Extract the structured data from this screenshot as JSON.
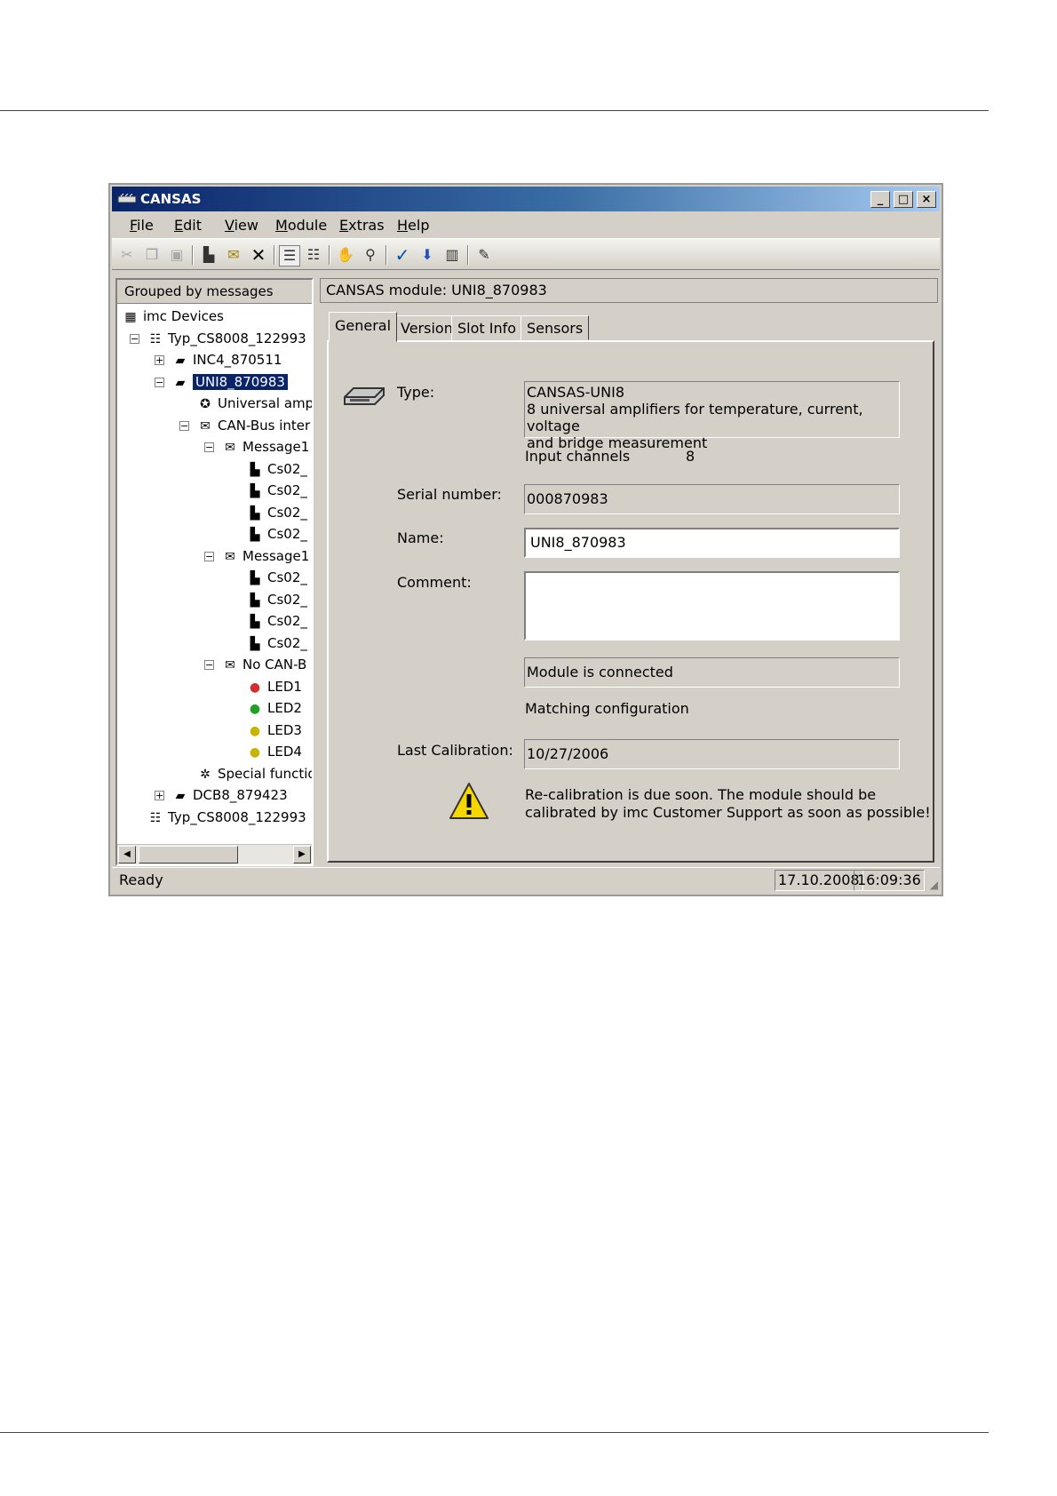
{
  "window": {
    "title": "CANSAS"
  },
  "menu": [
    {
      "label": "File",
      "key": "F",
      "rest": "ile"
    },
    {
      "label": "Edit",
      "key": "E",
      "rest": "dit"
    },
    {
      "label": "View",
      "key": "V",
      "rest": "iew"
    },
    {
      "label": "Module",
      "key": "M",
      "rest": "odule"
    },
    {
      "label": "Extras",
      "key": "E",
      "rest": "xtras"
    },
    {
      "label": "Help",
      "key": "H",
      "rest": "elp"
    }
  ],
  "left_panel": {
    "header": "Grouped by messages",
    "tree": [
      {
        "label": "imc Devices",
        "icon": "devices-icon",
        "glyph": "▦"
      },
      {
        "label": "Typ_CS8008_122993",
        "icon": "rack-icon",
        "glyph": "☷"
      },
      {
        "label": "INC4_870511",
        "icon": "module-icon",
        "glyph": "▰"
      },
      {
        "label": "UNI8_870983",
        "icon": "module-icon",
        "glyph": "▰"
      },
      {
        "label": "Universal amp",
        "icon": "amplifier-icon",
        "glyph": "✪"
      },
      {
        "label": "CAN-Bus inter",
        "icon": "can-bus-icon",
        "glyph": "✉"
      },
      {
        "label": "Message1",
        "icon": "envelope-icon",
        "glyph": "✉"
      },
      {
        "label": "Cs02_",
        "icon": "channel-icon",
        "glyph": "▙"
      },
      {
        "label": "Cs02_",
        "icon": "channel-icon",
        "glyph": "▙"
      },
      {
        "label": "Cs02_",
        "icon": "channel-icon",
        "glyph": "▙"
      },
      {
        "label": "Cs02_",
        "icon": "channel-icon",
        "glyph": "▙"
      },
      {
        "label": "Message1",
        "icon": "envelope-icon",
        "glyph": "✉"
      },
      {
        "label": "Cs02_",
        "icon": "channel-icon",
        "glyph": "▙"
      },
      {
        "label": "Cs02_",
        "icon": "channel-icon",
        "glyph": "▙"
      },
      {
        "label": "Cs02_",
        "icon": "channel-icon",
        "glyph": "▙"
      },
      {
        "label": "Cs02_",
        "icon": "channel-icon",
        "glyph": "▙"
      },
      {
        "label": "No CAN-B",
        "icon": "envelope-crossed-icon",
        "glyph": "✉"
      },
      {
        "label": "LED1",
        "icon": "led-red-icon",
        "glyph": "●",
        "color": "#d03030"
      },
      {
        "label": "LED2",
        "icon": "led-green-icon",
        "glyph": "●",
        "color": "#22a022"
      },
      {
        "label": "LED3",
        "icon": "led-yellow-icon",
        "glyph": "●",
        "color": "#c8b400"
      },
      {
        "label": "LED4",
        "icon": "led-yellow-icon",
        "glyph": "●",
        "color": "#c8b400"
      },
      {
        "label": "Special functio",
        "icon": "gear-icon",
        "glyph": "✲"
      },
      {
        "label": "DCB8_879423",
        "icon": "module-icon",
        "glyph": "▰"
      },
      {
        "label": "Typ_CS8008_122993",
        "icon": "rack-icon",
        "glyph": "☷"
      }
    ]
  },
  "right_panel": {
    "header": "CANSAS module: UNI8_870983",
    "tabs": [
      "General",
      "Version",
      "Slot Info",
      "Sensors"
    ],
    "general": {
      "type_label": "Type:",
      "type_line1": "CANSAS-UNI8",
      "type_line2": "8 universal amplifiers for temperature, current, voltage",
      "type_line3": "and bridge measurement",
      "input_channels_label": "Input channels",
      "input_channels_value": "8",
      "serial_label": "Serial number:",
      "serial_value": "000870983",
      "name_label": "Name:",
      "name_value": "UNI8_870983",
      "comment_label": "Comment:",
      "comment_value": "",
      "connection_status": "Module is connected",
      "config_status": "Matching configuration",
      "calibration_label": "Last Calibration:",
      "calibration_value": "10/27/2006",
      "warning_line1": "Re-calibration is due soon. The module should be",
      "warning_line2": "calibrated by imc Customer Support as soon as possible!"
    }
  },
  "status": {
    "text": "Ready",
    "date": "17.10.2008",
    "time": "16:09:36"
  },
  "colors": {
    "selection": "#0a246a",
    "titlebar": "#0a246a",
    "warning": "#f5d800"
  }
}
